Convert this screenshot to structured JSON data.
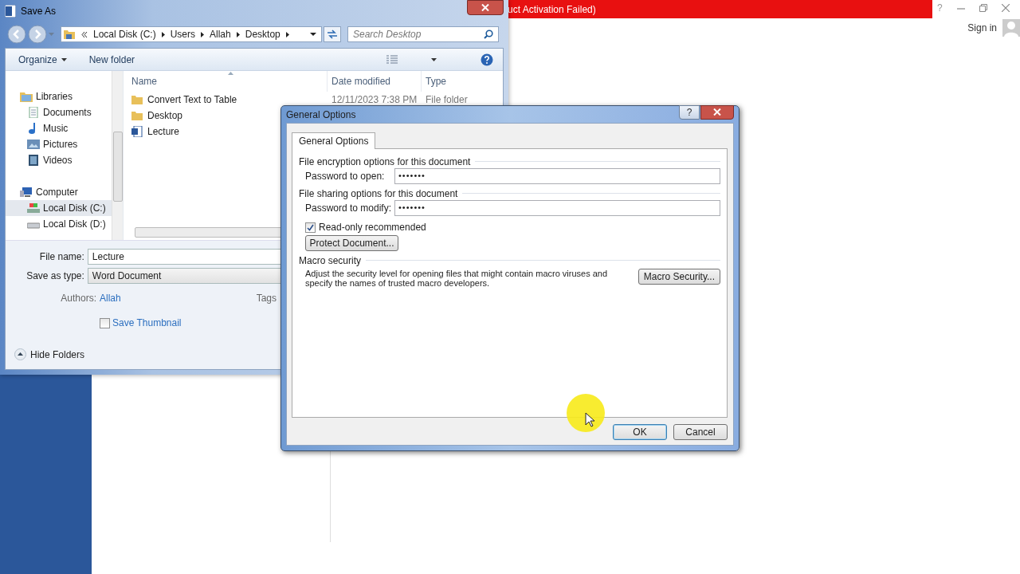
{
  "word_window": {
    "title": "uct Activation Failed)",
    "help": "?",
    "sign_in": "Sign in"
  },
  "save_as": {
    "title": "Save As",
    "breadcrumb": [
      "Local Disk (C:)",
      "Users",
      "Allah",
      "Desktop"
    ],
    "search_placeholder": "Search Desktop",
    "toolbar": [
      "Organize",
      "New folder"
    ],
    "nav": [
      {
        "label": "Libraries",
        "kind": "library",
        "selected": false,
        "children": [
          {
            "label": "Documents",
            "kind": "documents",
            "selected": false
          },
          {
            "label": "Music",
            "kind": "music",
            "selected": false
          },
          {
            "label": "Pictures",
            "kind": "pictures",
            "selected": false
          },
          {
            "label": "Videos",
            "kind": "videos",
            "selected": false
          }
        ]
      },
      {
        "label": "Computer",
        "kind": "computer",
        "selected": false,
        "children": [
          {
            "label": "Local Disk (C:)",
            "kind": "system-disk",
            "selected": true
          },
          {
            "label": "Local Disk (D:)",
            "kind": "disk",
            "selected": false
          }
        ]
      }
    ],
    "columns": [
      "Name",
      "Date modified",
      "Type"
    ],
    "files": [
      {
        "name": "Convert Text to Table",
        "kind": "folder",
        "date": "12/11/2023 7:38 PM",
        "type": "File folder"
      },
      {
        "name": "Desktop",
        "kind": "folder"
      },
      {
        "name": "Lecture",
        "kind": "document"
      }
    ],
    "file_name_label": "File name:",
    "file_name": "Lecture",
    "type_label": "Save as type:",
    "save_type": "Word Document",
    "authors_label": "Authors:",
    "authors": "Allah",
    "tags_label": "Tags",
    "save_thumbnail": {
      "label": "Save Thumbnail",
      "checked": false
    },
    "hide_folders": "Hide Folders"
  },
  "dialog": {
    "title": "General Options",
    "help": "?",
    "tabs": [
      {
        "label": "General Options",
        "selected": true
      }
    ],
    "encryption_heading": "File encryption options for this document",
    "open_label": "Password to open:",
    "open_value": "•••••••",
    "sharing_heading": "File sharing options for this document",
    "modify_label": "Password to modify:",
    "modify_value": "•••••••",
    "read_only": {
      "label": "Read-only recommended",
      "checked": true
    },
    "protect_button": "Protect Document...",
    "macro_heading": "Macro security",
    "macro_text": "Adjust the security level for opening files that might contain macro viruses and specify the names of trusted macro developers.",
    "macro_button": "Macro Security...",
    "ok": "OK",
    "cancel": "Cancel"
  }
}
